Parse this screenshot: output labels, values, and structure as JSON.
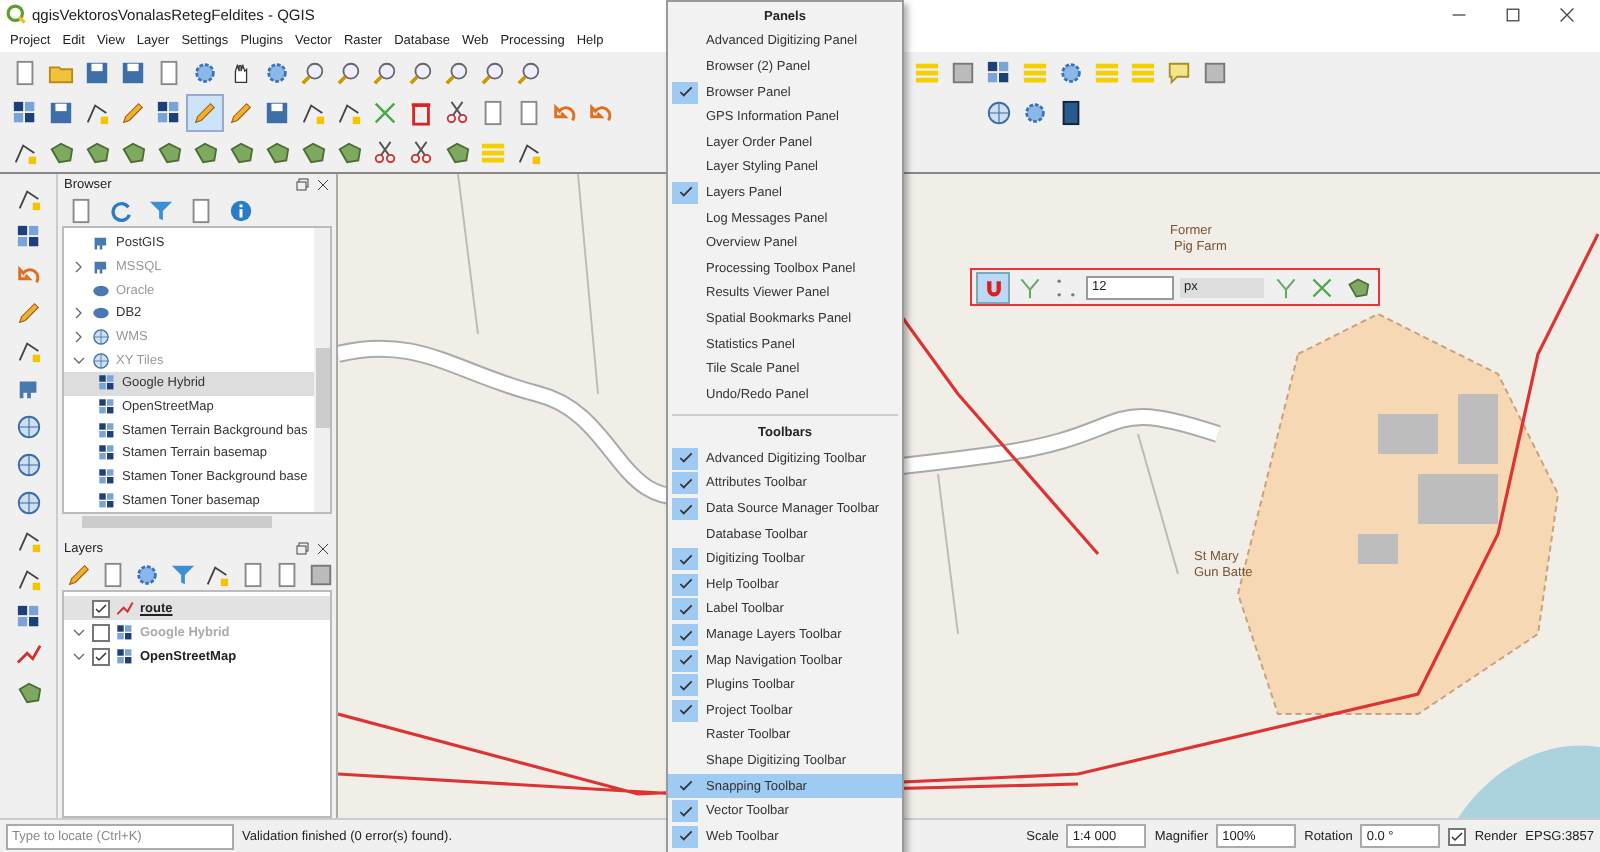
{
  "window": {
    "title": "qgisVektorosVonalasRetegFeldites - QGIS"
  },
  "menu_bar": [
    "Project",
    "Edit",
    "View",
    "Layer",
    "Settings",
    "Plugins",
    "Vector",
    "Raster",
    "Database",
    "Web",
    "Processing",
    "Help"
  ],
  "browser": {
    "title": "Browser",
    "items": [
      {
        "label": "PostGIS"
      },
      {
        "label": "MSSQL",
        "expanded": false
      },
      {
        "label": "Oracle"
      },
      {
        "label": "DB2",
        "expanded": false
      },
      {
        "label": "WMS",
        "expanded": false
      },
      {
        "label": "XY Tiles",
        "expanded": true,
        "children": [
          {
            "label": "Google Hybrid",
            "selected": true
          },
          {
            "label": "OpenStreetMap",
            "selected": false
          },
          {
            "label": "Stamen Terrain Background bas",
            "selected": false
          },
          {
            "label": "Stamen Terrain basemap",
            "selected": false
          },
          {
            "label": "Stamen Toner Background base",
            "selected": false
          },
          {
            "label": "Stamen Toner basemap",
            "selected": false
          }
        ]
      }
    ]
  },
  "layers": {
    "title": "Layers",
    "items": [
      {
        "label": "route",
        "kind": "vector",
        "checked": true,
        "selected": true
      },
      {
        "label": "Google Hybrid",
        "kind": "raster",
        "checked": false,
        "selected": false
      },
      {
        "label": "OpenStreetMap",
        "kind": "raster",
        "checked": true,
        "selected": false
      }
    ]
  },
  "context_menu": {
    "sections": [
      {
        "title": "Panels",
        "items": [
          {
            "label": "Advanced Digitizing Panel",
            "checked": false,
            "selected": false
          },
          {
            "label": "Browser (2) Panel",
            "checked": false,
            "selected": false
          },
          {
            "label": "Browser Panel",
            "checked": true,
            "selected": false
          },
          {
            "label": "GPS Information Panel",
            "checked": false,
            "selected": false
          },
          {
            "label": "Layer Order Panel",
            "checked": false,
            "selected": false
          },
          {
            "label": "Layer Styling Panel",
            "checked": false,
            "selected": false
          },
          {
            "label": "Layers Panel",
            "checked": true,
            "selected": false
          },
          {
            "label": "Log Messages Panel",
            "checked": false,
            "selected": false
          },
          {
            "label": "Overview Panel",
            "checked": false,
            "selected": false
          },
          {
            "label": "Processing Toolbox Panel",
            "checked": false,
            "selected": false
          },
          {
            "label": "Results Viewer Panel",
            "checked": false,
            "selected": false
          },
          {
            "label": "Spatial Bookmarks Panel",
            "checked": false,
            "selected": false
          },
          {
            "label": "Statistics Panel",
            "checked": false,
            "selected": false
          },
          {
            "label": "Tile Scale Panel",
            "checked": false,
            "selected": false
          },
          {
            "label": "Undo/Redo Panel",
            "checked": false,
            "selected": false
          }
        ]
      },
      {
        "title": "Toolbars",
        "items": [
          {
            "label": "Advanced Digitizing Toolbar",
            "checked": true,
            "selected": false
          },
          {
            "label": "Attributes Toolbar",
            "checked": true,
            "selected": false
          },
          {
            "label": "Data Source Manager Toolbar",
            "checked": true,
            "selected": false
          },
          {
            "label": "Database Toolbar",
            "checked": false,
            "selected": false
          },
          {
            "label": "Digitizing Toolbar",
            "checked": true,
            "selected": false
          },
          {
            "label": "Help Toolbar",
            "checked": true,
            "selected": false
          },
          {
            "label": "Label Toolbar",
            "checked": true,
            "selected": false
          },
          {
            "label": "Manage Layers Toolbar",
            "checked": true,
            "selected": false
          },
          {
            "label": "Map Navigation Toolbar",
            "checked": true,
            "selected": false
          },
          {
            "label": "Plugins Toolbar",
            "checked": true,
            "selected": false
          },
          {
            "label": "Project Toolbar",
            "checked": true,
            "selected": false
          },
          {
            "label": "Raster Toolbar",
            "checked": false,
            "selected": false
          },
          {
            "label": "Shape Digitizing Toolbar",
            "checked": false,
            "selected": false
          },
          {
            "label": "Snapping Toolbar",
            "checked": true,
            "selected": true
          },
          {
            "label": "Vector Toolbar",
            "checked": true,
            "selected": false
          },
          {
            "label": "Web Toolbar",
            "checked": true,
            "selected": false
          }
        ]
      }
    ]
  },
  "snapping_toolbar": {
    "enabled": true,
    "tolerance": "12",
    "unit": "px"
  },
  "map": {
    "labels": [
      "Former",
      "Pig Farm",
      "St Mary",
      "Gun Batte"
    ]
  },
  "status_bar": {
    "locate_placeholder": "Type to locate (Ctrl+K)",
    "message": "Validation finished (0 error(s) found).",
    "scale_label": "Scale",
    "scale": "1:4 000",
    "magnifier_label": "Magnifier",
    "magnifier": "100%",
    "rotation_label": "Rotation",
    "rotation": "0.0 °",
    "render_checked": true,
    "render_label": "Render",
    "crs": "EPSG:3857"
  }
}
